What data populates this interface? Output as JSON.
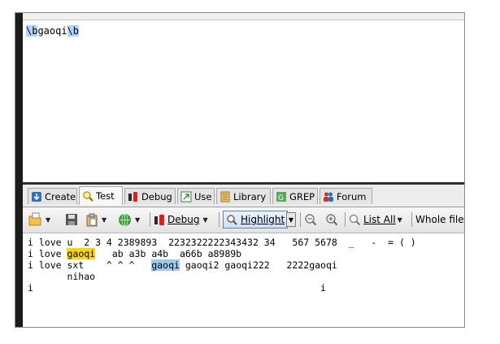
{
  "regex": {
    "tokens": [
      {
        "text": "\\b",
        "highlight": true
      },
      {
        "text": "gaoqi",
        "highlight": false
      },
      {
        "text": "\\b",
        "highlight": true
      }
    ]
  },
  "tabs": [
    {
      "label": "Create",
      "icon": "create-icon",
      "active": false
    },
    {
      "label": "Test",
      "icon": "magnifier-icon",
      "active": true
    },
    {
      "label": "Debug",
      "icon": "debug-icon",
      "active": false
    },
    {
      "label": "Use",
      "icon": "use-icon",
      "active": false
    },
    {
      "label": "Library",
      "icon": "library-icon",
      "active": false
    },
    {
      "label": "GREP",
      "icon": "grep-icon",
      "active": false
    },
    {
      "label": "Forum",
      "icon": "forum-icon",
      "active": false
    }
  ],
  "toolbar": {
    "debug_label": "Debug",
    "highlight_label": "Highlight",
    "list_all_label": "List All",
    "whole_file_label": "Whole file"
  },
  "test_text": {
    "line1": "i love u  2 3 4 2389893  2232322222343432 34   567 5678  _   -  = ( )",
    "line2_pre": "i love ",
    "line2_match": "gaoqi",
    "line2_post": "   ab a3b a4b  a66b a8989b",
    "line3_pre": "i love sxt    ^ ^ ^   ",
    "line3_match": "gaoqi",
    "line3_post": " gaoqi2 gaoqi222   2222gaoqi",
    "line4": "       nihao",
    "line5": "i                                                   i"
  },
  "colors": {
    "match_primary": "#ffd700",
    "match_secondary": "#9dc9f0",
    "regex_token": "#aed7ff"
  }
}
